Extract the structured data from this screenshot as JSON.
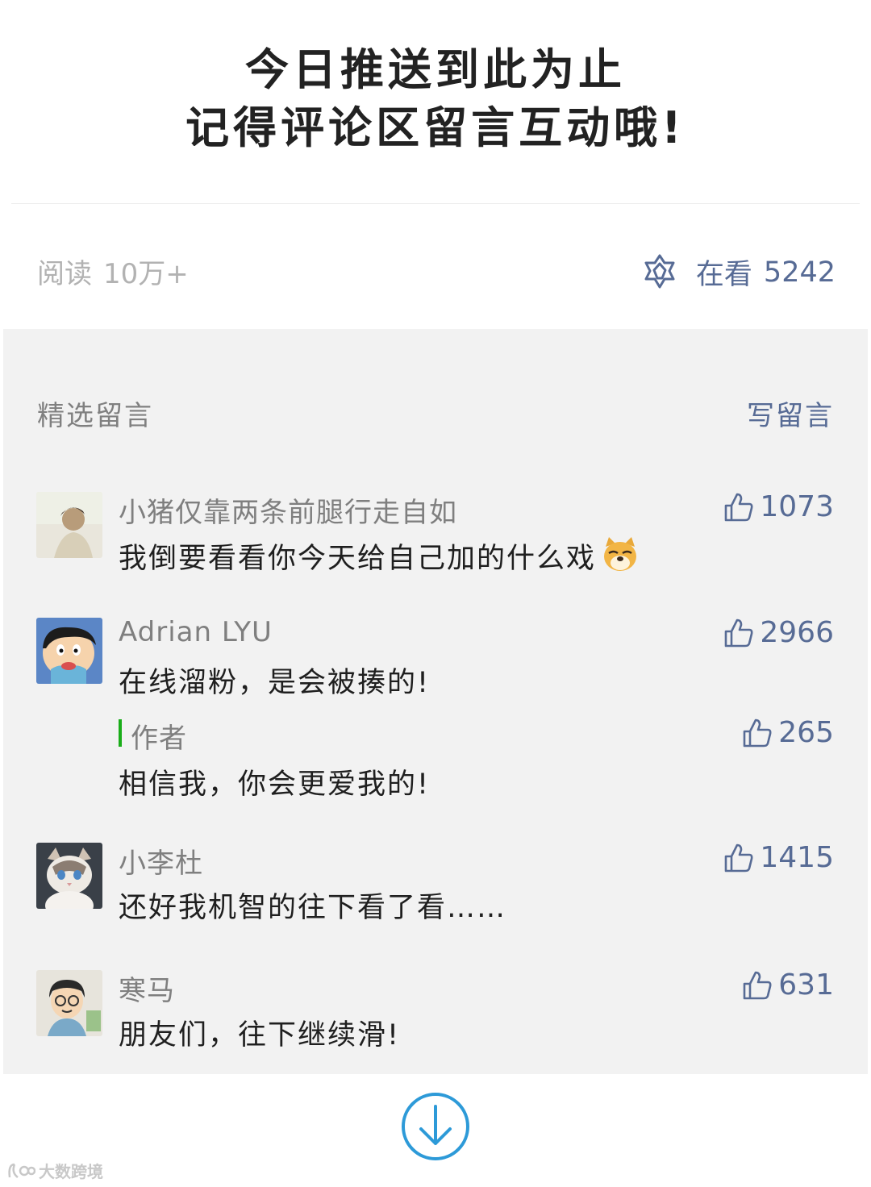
{
  "header": {
    "line1": "今日推送到此为止",
    "line2": "记得评论区留言互动哦!"
  },
  "stats": {
    "read_label": "阅读",
    "read_count": "10万+",
    "watch_label": "在看",
    "watch_count": "5242",
    "accent_color": "#576b95"
  },
  "comments_section": {
    "title": "精选留言",
    "write_label": "写留言"
  },
  "comments": [
    {
      "nickname": "小猪仅靠两条前腿行走自如",
      "text": "我倒要看看你今天给自己加的什么戏",
      "likes": "1073",
      "emoji": "doge-emoji"
    },
    {
      "nickname": "Adrian LYU",
      "text": "在线溜粉，是会被揍的!",
      "likes": "2966",
      "reply": {
        "author_label": "作者",
        "text": "相信我，你会更爱我的!",
        "likes": "265"
      }
    },
    {
      "nickname": "小李杜",
      "text": "还好我机智的往下看了看……",
      "likes": "1415"
    },
    {
      "nickname": "寒马",
      "text": "朋友们，往下继续滑!",
      "likes": "631"
    }
  ],
  "footer": {
    "icon": "arrow-down-circle-icon",
    "watermark_text": "大数跨境"
  }
}
